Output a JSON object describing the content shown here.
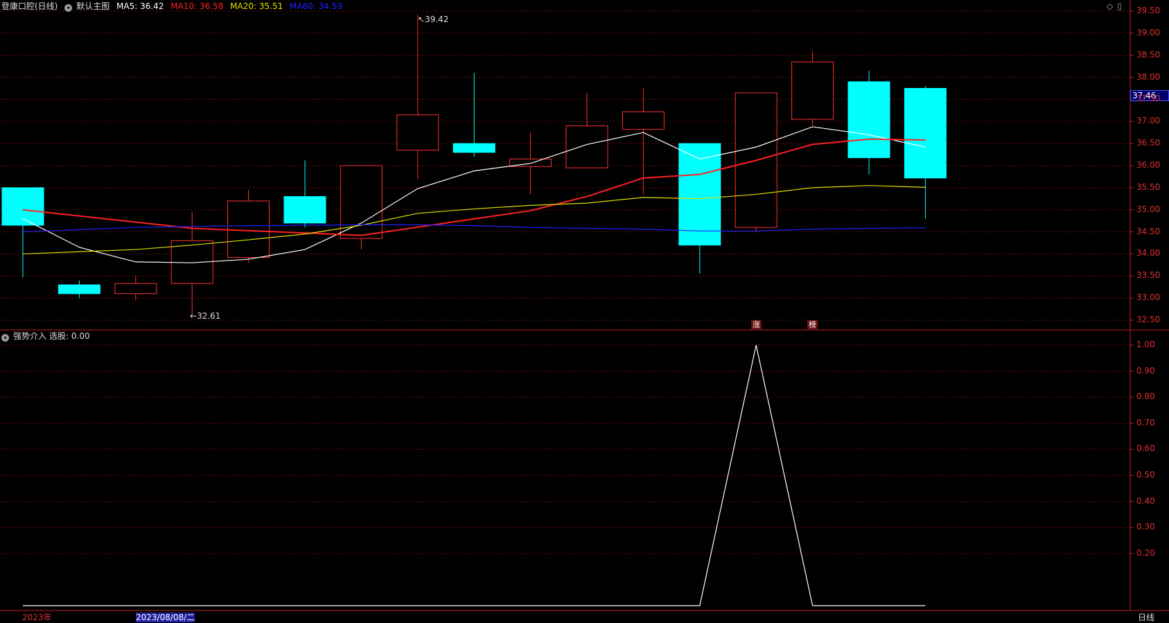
{
  "header_main": {
    "stock": "登康口腔(日线)",
    "indicator_label": "默认主图",
    "ma5": "MA5: 36.42",
    "ma10": "MA10: 36.58",
    "ma20": "MA20: 35.51",
    "ma60": "MA60: 34.59"
  },
  "header_sub": {
    "indicator_label": "强势介入",
    "value": "选股: 0.00"
  },
  "price_tag": "37.46",
  "annotations": {
    "high": "39.42",
    "low": "32.61"
  },
  "badges": [
    "涨",
    "榜"
  ],
  "footer": {
    "year": "2023年",
    "date": "2023/08/08/二",
    "period": "日线"
  },
  "colors": {
    "up": "#ff3232",
    "down": "#00ffff",
    "ma5": "#ffffff",
    "ma10": "#ff2020",
    "ma20": "#e0e000",
    "ma60": "#2020ff",
    "grid": "#7a1010"
  },
  "chart_data": [
    {
      "type": "candlestick",
      "title": "登康口腔(日线)",
      "ylim": [
        32.25,
        39.75
      ],
      "yticks": [
        "39.50",
        "39.00",
        "38.50",
        "38.00",
        "37.50",
        "37.00",
        "36.50",
        "36.00",
        "35.50",
        "35.00",
        "34.50",
        "34.00",
        "33.50",
        "33.00",
        "32.50"
      ],
      "candles": [
        {
          "open": 35.5,
          "close": 34.65,
          "high": 35.5,
          "low": 33.47
        },
        {
          "open": 33.3,
          "close": 33.1,
          "high": 33.4,
          "low": 33.0
        },
        {
          "open": 33.1,
          "close": 33.33,
          "high": 33.5,
          "low": 32.95
        },
        {
          "open": 33.33,
          "close": 34.3,
          "high": 34.95,
          "low": 32.61
        },
        {
          "open": 33.92,
          "close": 35.2,
          "high": 35.45,
          "low": 33.8
        },
        {
          "open": 35.3,
          "close": 34.7,
          "high": 36.12,
          "low": 34.6
        },
        {
          "open": 34.35,
          "close": 36.0,
          "high": 36.0,
          "low": 34.1
        },
        {
          "open": 36.35,
          "close": 37.15,
          "high": 39.42,
          "low": 35.7
        },
        {
          "open": 36.5,
          "close": 36.3,
          "high": 38.1,
          "low": 36.2
        },
        {
          "open": 35.98,
          "close": 36.15,
          "high": 36.75,
          "low": 35.35
        },
        {
          "open": 35.95,
          "close": 36.9,
          "high": 37.65,
          "low": 35.95
        },
        {
          "open": 36.82,
          "close": 37.22,
          "high": 37.75,
          "low": 35.35
        },
        {
          "open": 36.5,
          "close": 34.2,
          "high": 36.5,
          "low": 33.55
        },
        {
          "open": 34.6,
          "close": 37.65,
          "high": 37.65,
          "low": 34.5
        },
        {
          "open": 37.05,
          "close": 38.35,
          "high": 38.58,
          "low": 36.9
        },
        {
          "open": 37.9,
          "close": 36.18,
          "high": 38.15,
          "low": 35.8
        },
        {
          "open": 37.75,
          "close": 35.72,
          "high": 37.8,
          "low": 34.8
        }
      ],
      "series": [
        {
          "name": "MA5",
          "values": [
            34.8,
            34.15,
            33.82,
            33.8,
            33.88,
            34.1,
            34.7,
            35.48,
            35.88,
            36.05,
            36.48,
            36.75,
            36.15,
            36.42,
            36.88,
            36.7,
            36.42
          ]
        },
        {
          "name": "MA10",
          "values": [
            35.0,
            null,
            null,
            34.58,
            null,
            null,
            34.42,
            null,
            null,
            34.98,
            35.3,
            35.72,
            35.8,
            36.12,
            36.48,
            36.6,
            36.58
          ]
        },
        {
          "name": "MA20",
          "values": [
            34.0,
            34.05,
            34.1,
            34.2,
            34.32,
            34.45,
            34.65,
            34.92,
            35.02,
            35.1,
            35.15,
            35.28,
            35.25,
            35.35,
            35.5,
            35.55,
            35.51
          ]
        },
        {
          "name": "MA60",
          "values": [
            34.5,
            34.55,
            34.6,
            34.62,
            34.64,
            34.65,
            34.66,
            34.66,
            34.64,
            34.6,
            34.58,
            34.56,
            34.52,
            34.52,
            34.56,
            34.58,
            34.59
          ]
        }
      ]
    },
    {
      "type": "line",
      "title": "强势介入",
      "ylim": [
        0,
        1.05
      ],
      "yticks": [
        "1.00",
        "0.90",
        "0.80",
        "0.70",
        "0.60",
        "0.50",
        "0.40",
        "0.30",
        "0.20"
      ],
      "series": [
        {
          "name": "选股",
          "values": [
            0,
            0,
            0,
            0,
            0,
            0,
            0,
            0,
            0,
            0,
            0,
            0,
            0,
            1,
            0,
            0,
            0
          ]
        }
      ]
    }
  ]
}
